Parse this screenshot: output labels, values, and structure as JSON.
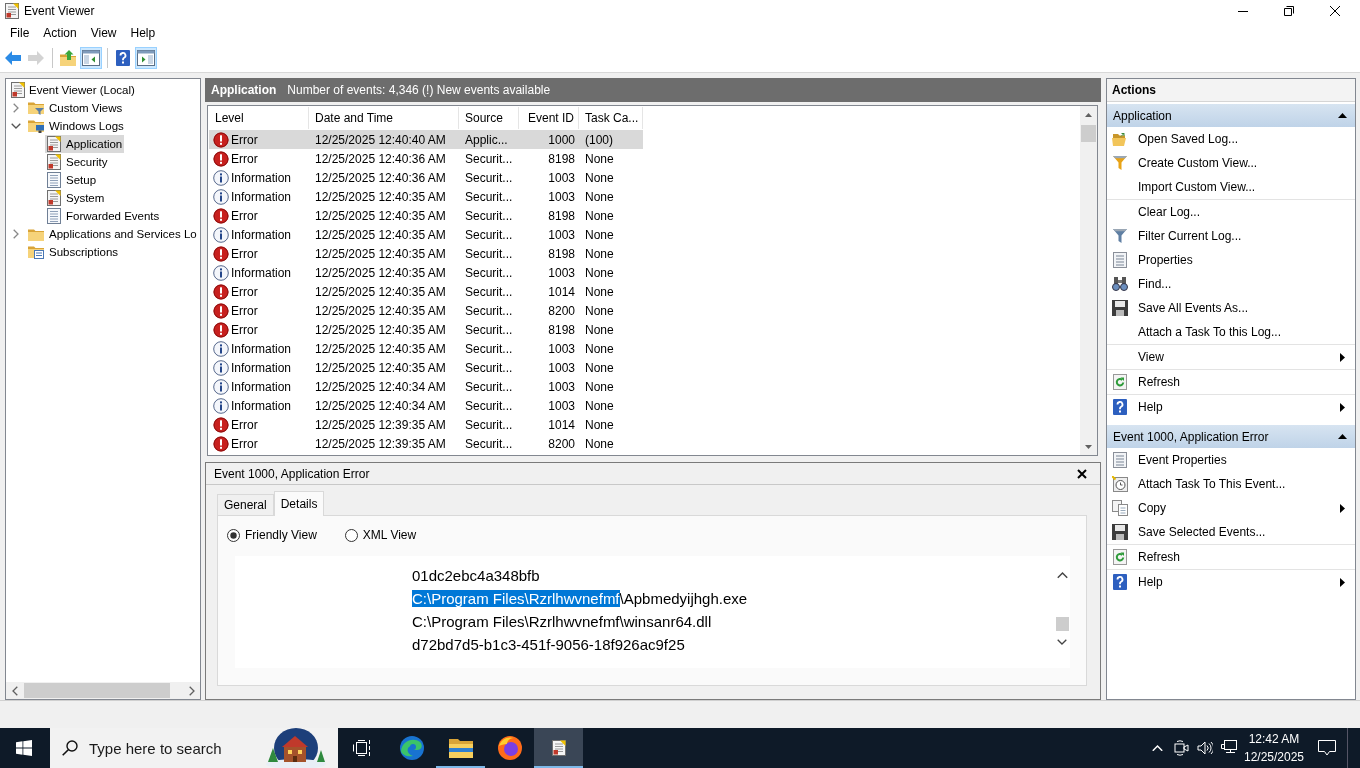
{
  "window": {
    "title": "Event Viewer"
  },
  "menu": [
    "File",
    "Action",
    "View",
    "Help"
  ],
  "toolbar": [
    {
      "kind": "back",
      "pressed": false,
      "disabled": false
    },
    {
      "kind": "forward",
      "pressed": false,
      "disabled": true
    },
    {
      "kind": "up",
      "pressed": false,
      "disabled": false
    },
    {
      "kind": "tree",
      "pressed": true,
      "disabled": false
    },
    {
      "kind": "help",
      "pressed": false,
      "disabled": false
    },
    {
      "kind": "actions",
      "pressed": true,
      "disabled": false
    }
  ],
  "tree": [
    {
      "label": "Event Viewer (Local)",
      "kind": "root",
      "selected": false,
      "children": [
        {
          "label": "Custom Views",
          "kind": "views",
          "expanded": false,
          "selected": false
        },
        {
          "label": "Windows Logs",
          "kind": "logs",
          "expanded": true,
          "selected": false,
          "children": [
            {
              "label": "Application",
              "kind": "log",
              "selected": true
            },
            {
              "label": "Security",
              "kind": "log",
              "selected": false
            },
            {
              "label": "Setup",
              "kind": "plain",
              "selected": false
            },
            {
              "label": "System",
              "kind": "log",
              "selected": false
            },
            {
              "label": "Forwarded Events",
              "kind": "plain",
              "selected": false
            }
          ]
        },
        {
          "label": "Applications and Services Lo",
          "kind": "folder",
          "expanded": false,
          "selected": false
        },
        {
          "label": "Subscriptions",
          "kind": "subscriptions",
          "selected": false
        }
      ]
    }
  ],
  "log_header": {
    "title": "Application",
    "summary": "Number of events: 4,346 (!) New events available"
  },
  "table": {
    "columns": [
      "Level",
      "Date and Time",
      "Source",
      "Event ID",
      "Task Ca..."
    ],
    "rows": [
      {
        "kind": "error",
        "level": "Error",
        "date_time": "12/25/2025 12:40:40 AM",
        "source": "Applic...",
        "event_id": "1000",
        "task_category": "(100)",
        "selected": true
      },
      {
        "kind": "error",
        "level": "Error",
        "date_time": "12/25/2025 12:40:36 AM",
        "source": "Securit...",
        "event_id": "8198",
        "task_category": "None",
        "selected": false
      },
      {
        "kind": "info",
        "level": "Information",
        "date_time": "12/25/2025 12:40:36 AM",
        "source": "Securit...",
        "event_id": "1003",
        "task_category": "None",
        "selected": false
      },
      {
        "kind": "info",
        "level": "Information",
        "date_time": "12/25/2025 12:40:35 AM",
        "source": "Securit...",
        "event_id": "1003",
        "task_category": "None",
        "selected": false
      },
      {
        "kind": "error",
        "level": "Error",
        "date_time": "12/25/2025 12:40:35 AM",
        "source": "Securit...",
        "event_id": "8198",
        "task_category": "None",
        "selected": false
      },
      {
        "kind": "info",
        "level": "Information",
        "date_time": "12/25/2025 12:40:35 AM",
        "source": "Securit...",
        "event_id": "1003",
        "task_category": "None",
        "selected": false
      },
      {
        "kind": "error",
        "level": "Error",
        "date_time": "12/25/2025 12:40:35 AM",
        "source": "Securit...",
        "event_id": "8198",
        "task_category": "None",
        "selected": false
      },
      {
        "kind": "info",
        "level": "Information",
        "date_time": "12/25/2025 12:40:35 AM",
        "source": "Securit...",
        "event_id": "1003",
        "task_category": "None",
        "selected": false
      },
      {
        "kind": "error",
        "level": "Error",
        "date_time": "12/25/2025 12:40:35 AM",
        "source": "Securit...",
        "event_id": "1014",
        "task_category": "None",
        "selected": false
      },
      {
        "kind": "error",
        "level": "Error",
        "date_time": "12/25/2025 12:40:35 AM",
        "source": "Securit...",
        "event_id": "8200",
        "task_category": "None",
        "selected": false
      },
      {
        "kind": "error",
        "level": "Error",
        "date_time": "12/25/2025 12:40:35 AM",
        "source": "Securit...",
        "event_id": "8198",
        "task_category": "None",
        "selected": false
      },
      {
        "kind": "info",
        "level": "Information",
        "date_time": "12/25/2025 12:40:35 AM",
        "source": "Securit...",
        "event_id": "1003",
        "task_category": "None",
        "selected": false
      },
      {
        "kind": "info",
        "level": "Information",
        "date_time": "12/25/2025 12:40:35 AM",
        "source": "Securit...",
        "event_id": "1003",
        "task_category": "None",
        "selected": false
      },
      {
        "kind": "info",
        "level": "Information",
        "date_time": "12/25/2025 12:40:34 AM",
        "source": "Securit...",
        "event_id": "1003",
        "task_category": "None",
        "selected": false
      },
      {
        "kind": "info",
        "level": "Information",
        "date_time": "12/25/2025 12:40:34 AM",
        "source": "Securit...",
        "event_id": "1003",
        "task_category": "None",
        "selected": false
      },
      {
        "kind": "error",
        "level": "Error",
        "date_time": "12/25/2025 12:39:35 AM",
        "source": "Securit...",
        "event_id": "1014",
        "task_category": "None",
        "selected": false
      },
      {
        "kind": "error",
        "level": "Error",
        "date_time": "12/25/2025 12:39:35 AM",
        "source": "Securit...",
        "event_id": "8200",
        "task_category": "None",
        "selected": false
      }
    ]
  },
  "details": {
    "title": "Event 1000, Application Error",
    "tabs": [
      {
        "label": "General",
        "selected": false
      },
      {
        "label": "Details",
        "selected": true
      }
    ],
    "views": [
      {
        "label": "Friendly View",
        "selected": true
      },
      {
        "label": "XML View",
        "selected": false
      }
    ],
    "lines": [
      {
        "segments": [
          {
            "text": "01dc2ebc4a348bfb",
            "selected": false
          }
        ]
      },
      {
        "segments": [
          {
            "text": "C:\\Program Files\\Rzrlhwvnefmf",
            "selected": true
          },
          {
            "text": "\\Apbmedyijhgh.exe",
            "selected": false
          }
        ]
      },
      {
        "segments": [
          {
            "text": "C:\\Program Files\\Rzrlhwvnefmf\\winsanr64.dll",
            "selected": false
          }
        ]
      },
      {
        "segments": [
          {
            "text": "d72bd7d5-b1c3-451f-9056-18f926ac9f25",
            "selected": false
          }
        ]
      }
    ]
  },
  "actions": {
    "title": "Actions",
    "sections": [
      {
        "title": "Application",
        "expanded": true,
        "items": [
          {
            "label": "Open Saved Log...",
            "kind": "open",
            "submenu": false,
            "divider_above": false
          },
          {
            "label": "Create Custom View...",
            "kind": "filter-new",
            "submenu": false,
            "divider_above": false
          },
          {
            "label": "Import Custom View...",
            "kind": "plain",
            "submenu": false,
            "divider_above": false
          },
          {
            "label": "Clear Log...",
            "kind": "plain",
            "submenu": false,
            "divider_above": true
          },
          {
            "label": "Filter Current Log...",
            "kind": "filter",
            "submenu": false,
            "divider_above": false
          },
          {
            "label": "Properties",
            "kind": "properties",
            "submenu": false,
            "divider_above": false
          },
          {
            "label": "Find...",
            "kind": "find",
            "submenu": false,
            "divider_above": false
          },
          {
            "label": "Save All Events As...",
            "kind": "save",
            "submenu": false,
            "divider_above": false
          },
          {
            "label": "Attach a Task To this Log...",
            "kind": "plain",
            "submenu": false,
            "divider_above": false
          },
          {
            "label": "View",
            "kind": "plain",
            "submenu": true,
            "divider_above": true
          },
          {
            "label": "Refresh",
            "kind": "refresh",
            "submenu": false,
            "divider_above": true
          },
          {
            "label": "Help",
            "kind": "help",
            "submenu": true,
            "divider_above": true
          }
        ]
      },
      {
        "title": "Event 1000, Application Error",
        "expanded": true,
        "items": [
          {
            "label": "Event Properties",
            "kind": "properties",
            "submenu": false,
            "divider_above": false
          },
          {
            "label": "Attach Task To This Event...",
            "kind": "task",
            "submenu": false,
            "divider_above": false
          },
          {
            "label": "Copy",
            "kind": "copy",
            "submenu": true,
            "divider_above": false
          },
          {
            "label": "Save Selected Events...",
            "kind": "save",
            "submenu": false,
            "divider_above": false
          },
          {
            "label": "Refresh",
            "kind": "refresh",
            "submenu": false,
            "divider_above": true
          },
          {
            "label": "Help",
            "kind": "help",
            "submenu": true,
            "divider_above": true
          }
        ]
      }
    ]
  },
  "taskbar": {
    "search": {
      "placeholder": "Type here to search"
    },
    "apps": [
      {
        "kind": "taskview",
        "running": false,
        "active": false
      },
      {
        "kind": "browser",
        "running": false,
        "active": false
      },
      {
        "kind": "files",
        "running": true,
        "active": false
      },
      {
        "kind": "browser-fox",
        "running": false,
        "active": false
      },
      {
        "kind": "eventlog",
        "running": true,
        "active": true
      }
    ],
    "clock": {
      "time": "12:42 AM",
      "date": "12/25/2025"
    }
  }
}
